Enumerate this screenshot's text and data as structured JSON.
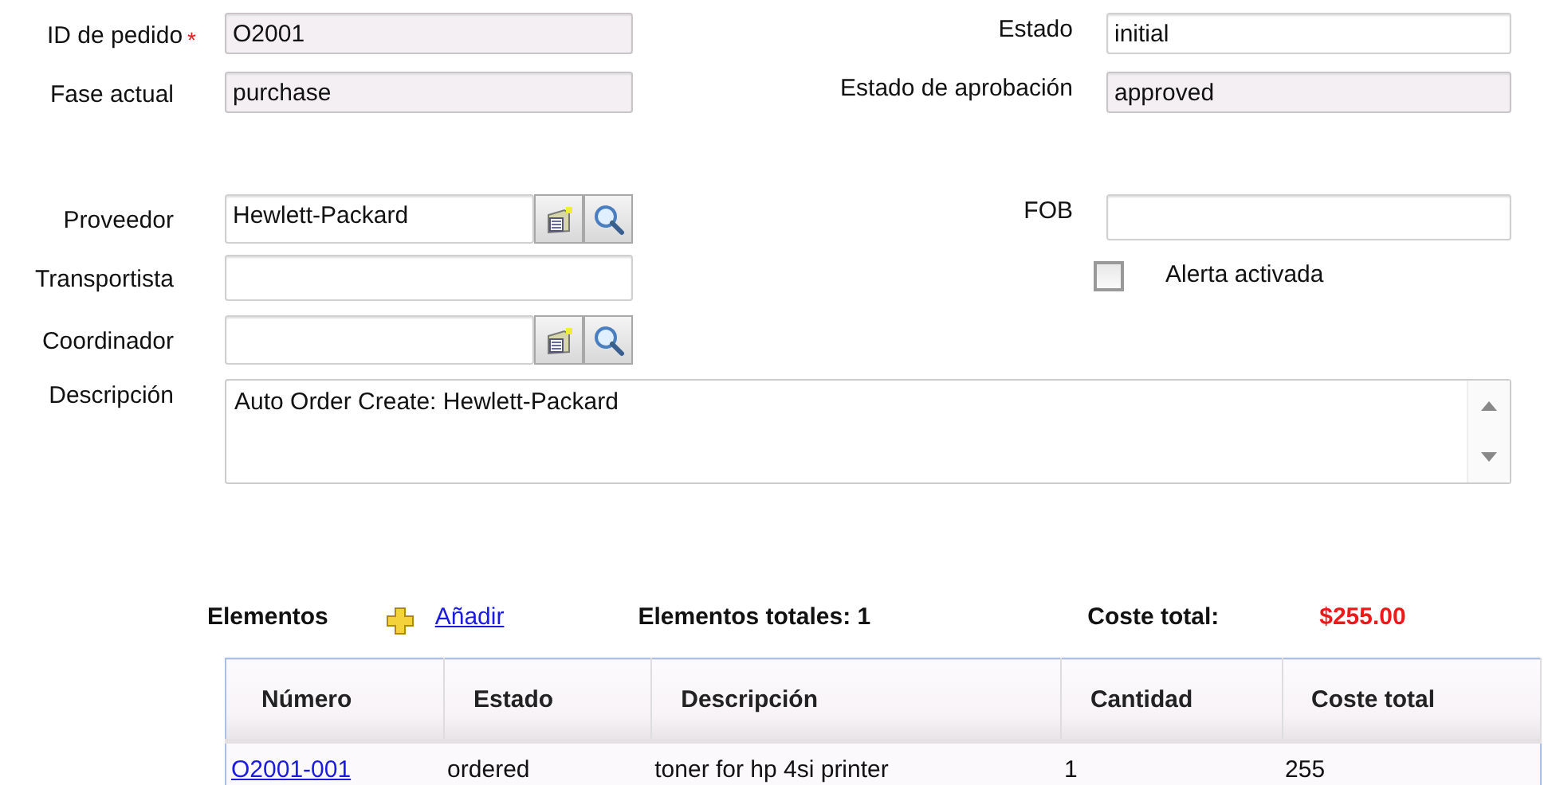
{
  "form_rows": [
    {
      "left": {
        "label": "ID de pedido",
        "required_mark": "*",
        "readonly": true,
        "value": "O2001",
        "lookup": false
      },
      "right": {
        "kind": "field",
        "label": "Estado",
        "readonly": false,
        "value": "initial"
      }
    },
    {
      "left": {
        "label": "Fase actual",
        "readonly": true,
        "value": "purchase",
        "lookup": false
      },
      "right": {
        "kind": "field",
        "label": "Estado de aprobación",
        "readonly": true,
        "value": "approved"
      }
    },
    {
      "left": {
        "label": "Proveedor",
        "readonly": false,
        "value": "Hewlett-Packard",
        "lookup": true
      },
      "right": {
        "kind": "field",
        "label": "FOB",
        "readonly": false
      }
    },
    {
      "left": {
        "label": "Transportista",
        "readonly": false,
        "lookup": false
      },
      "right": {
        "kind": "checkbox",
        "label": "Alerta activada",
        "checked": false
      }
    },
    {
      "left": {
        "label": "Coordinador",
        "readonly": false,
        "lookup": true
      }
    }
  ],
  "description": {
    "label": "Descripción",
    "value": "Auto Order Create: Hewlett-Packard"
  },
  "items": {
    "title": "Elementos",
    "add_link": "Añadir",
    "total_items": "Elementos totales: 1",
    "total_cost_label": "Coste total:",
    "total_cost": "$255.00",
    "table": {
      "columns": [
        "Número",
        "Estado",
        "Descripción",
        "Cantidad",
        "Coste total"
      ],
      "rows": [
        {
          "number": "O2001-001",
          "status": "ordered",
          "description": "toner for hp 4si printer",
          "quantity": "1",
          "cost": "255"
        }
      ]
    }
  }
}
